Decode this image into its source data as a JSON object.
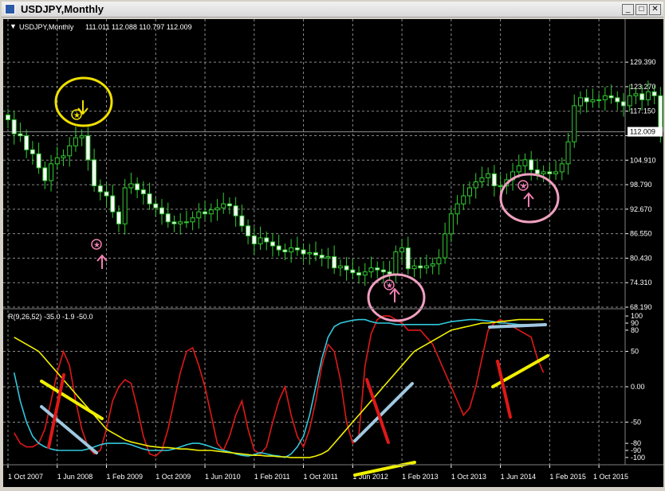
{
  "window": {
    "title": "USDJPY,Monthly",
    "min_glyph": "_",
    "max_glyph": "□",
    "close_glyph": "✕"
  },
  "chart_data": [
    {
      "type": "candlestick",
      "header": "USDJPY,Monthly",
      "ohlc_readout": "111.011 112.088 110.797 112.009",
      "current_price_label": "112.009",
      "current_price": 112.009,
      "y_ticks": [
        129.39,
        123.27,
        117.15,
        111.03,
        104.91,
        98.79,
        92.67,
        86.55,
        80.43,
        74.31,
        68.19
      ],
      "y_tick_labels": [
        "129.390",
        "123.270",
        "117.150",
        "",
        "104.910",
        "98.790",
        "92.670",
        "86.550",
        "80.430",
        "74.310",
        "68.190"
      ],
      "ylim": [
        68.19,
        132.2
      ],
      "x_ticks": [
        {
          "i": 0,
          "label": "1 Oct 2007"
        },
        {
          "i": 8,
          "label": "1 Jun 2008"
        },
        {
          "i": 16,
          "label": "1 Feb 2009"
        },
        {
          "i": 24,
          "label": "1 Oct 2009"
        },
        {
          "i": 32,
          "label": "1 Jun 2010"
        },
        {
          "i": 40,
          "label": "1 Feb 2011"
        },
        {
          "i": 48,
          "label": "1 Oct 2011"
        },
        {
          "i": 56,
          "label": "1 Jun 2012"
        },
        {
          "i": 64,
          "label": "1 Feb 2013"
        },
        {
          "i": 72,
          "label": "1 Oct 2013"
        },
        {
          "i": 80,
          "label": "1 Jun 2014"
        },
        {
          "i": 88,
          "label": "1 Feb 2015"
        },
        {
          "i": 96,
          "label": "1 Oct 2015"
        }
      ],
      "closes": [
        115.0,
        111.5,
        111.0,
        107.5,
        106.5,
        103.0,
        99.8,
        104.0,
        105.5,
        106.0,
        108.5,
        110.5,
        111.0,
        105.0,
        98.5,
        97.0,
        96.0,
        92.0,
        89.0,
        98.0,
        99.0,
        97.5,
        96.5,
        94.0,
        93.0,
        91.5,
        89.5,
        89.0,
        89.5,
        89.5,
        90.5,
        92.0,
        91.5,
        92.5,
        93.0,
        94.0,
        93.5,
        91.0,
        88.5,
        86.0,
        84.0,
        85.5,
        84.5,
        83.5,
        82.5,
        82.0,
        83.0,
        82.5,
        81.5,
        81.8,
        81.2,
        80.5,
        80.8,
        78.0,
        78.5,
        77.5,
        76.8,
        76.2,
        77.0,
        78.0,
        77.5,
        77.0,
        76.5,
        82.0,
        83.0,
        77.8,
        78.5,
        78.0,
        78.5,
        79.0,
        80.5,
        86.5,
        91.5,
        94.0,
        96.0,
        98.0,
        99.5,
        100.5,
        101.5,
        98.5,
        98.5,
        100.0,
        102.0,
        103.5,
        105.0,
        102.5,
        101.5,
        102.0,
        101.5,
        102.0,
        104.0,
        109.5,
        118.5,
        120.5,
        119.5,
        120.0,
        120.0,
        121.0,
        120.5,
        119.5,
        118.5,
        121.0,
        121.5,
        120.0,
        122.0,
        121.0,
        112.009
      ]
    },
    {
      "type": "line",
      "header": "R(9,26,52) -35.0 -1.9 -50.0",
      "ylim": [
        -108,
        108
      ],
      "y_ticks": [
        100,
        90,
        80,
        50,
        0,
        -50,
        -80,
        -90,
        -100
      ],
      "y_tick_labels": [
        "100",
        "90",
        "80",
        "50",
        "0.00",
        "-50",
        "-80",
        "-90",
        "-100"
      ],
      "series": [
        {
          "color": "#e01818",
          "values": [
            -65,
            -80,
            -85,
            -85,
            -80,
            -60,
            -20,
            20,
            50,
            30,
            -20,
            -60,
            -85,
            -95,
            -90,
            -60,
            -20,
            0,
            10,
            5,
            -30,
            -70,
            -95,
            -98,
            -90,
            -60,
            -20,
            20,
            50,
            55,
            30,
            0,
            -40,
            -80,
            -90,
            -70,
            -40,
            -20,
            -60,
            -90,
            -95,
            -85,
            -50,
            -20,
            0,
            -40,
            -70,
            -85,
            -60,
            -20,
            30,
            60,
            50,
            10,
            -50,
            -80,
            -70,
            30,
            75,
            95,
            100,
            100,
            95,
            90,
            80,
            80,
            80,
            70,
            60,
            40,
            20,
            0,
            -20,
            -40,
            -30,
            0,
            40,
            80,
            90,
            95,
            90,
            85,
            80,
            75,
            70,
            40,
            20
          ]
        },
        {
          "color": "#32c8dc",
          "values": [
            20,
            -20,
            -50,
            -70,
            -80,
            -85,
            -88,
            -90,
            -90,
            -90,
            -90,
            -90,
            -88,
            -85,
            -82,
            -80,
            -80,
            -80,
            -80,
            -82,
            -85,
            -88,
            -90,
            -90,
            -90,
            -90,
            -88,
            -85,
            -82,
            -80,
            -80,
            -82,
            -85,
            -88,
            -90,
            -92,
            -95,
            -97,
            -98,
            -96,
            -93,
            -95,
            -97,
            -98,
            -100,
            -95,
            -85,
            -70,
            -40,
            0,
            40,
            70,
            85,
            90,
            92,
            94,
            95,
            95,
            92,
            90,
            90,
            90,
            88,
            88,
            88,
            88,
            88,
            88,
            88,
            88,
            90,
            92,
            93,
            94,
            95,
            95,
            94,
            93,
            92,
            90,
            90,
            89,
            88,
            88,
            88,
            88,
            88
          ]
        },
        {
          "color": "#f0f000",
          "values": [
            70,
            65,
            60,
            55,
            50,
            40,
            30,
            20,
            10,
            0,
            -10,
            -20,
            -30,
            -40,
            -50,
            -60,
            -65,
            -70,
            -75,
            -78,
            -80,
            -82,
            -84,
            -85,
            -86,
            -86,
            -87,
            -88,
            -88,
            -89,
            -90,
            -90,
            -90,
            -91,
            -92,
            -93,
            -94,
            -95,
            -96,
            -97,
            -97,
            -98,
            -98,
            -99,
            -99,
            -100,
            -100,
            -100,
            -100,
            -98,
            -95,
            -90,
            -80,
            -70,
            -60,
            -50,
            -40,
            -30,
            -20,
            -10,
            0,
            10,
            20,
            30,
            40,
            50,
            55,
            60,
            65,
            70,
            75,
            80,
            82,
            84,
            86,
            88,
            90,
            90,
            91,
            92,
            93,
            94,
            95,
            95,
            95,
            95,
            95
          ]
        }
      ]
    }
  ],
  "annotations": [
    {
      "name": "sell-signal-circle",
      "shape": "circle",
      "color": "#f0e000"
    },
    {
      "name": "buy-signal-circle-1",
      "shape": "circle",
      "color": "#f0a0c0"
    },
    {
      "name": "buy-signal-circle-2",
      "shape": "circle",
      "color": "#f0a0c0"
    },
    {
      "name": "sell-arrow-icon",
      "color": "#f0e000"
    },
    {
      "name": "buy-arrow-icon",
      "color": "#f080b0"
    },
    {
      "name": "trend-marker-red",
      "color": "#e01818"
    },
    {
      "name": "trend-marker-yellow",
      "color": "#f0f000"
    },
    {
      "name": "trend-marker-lightblue",
      "color": "#a0c8e0"
    }
  ]
}
